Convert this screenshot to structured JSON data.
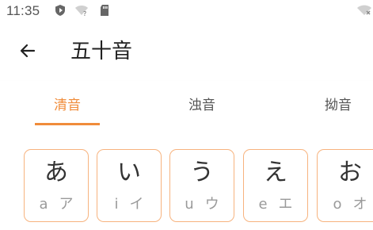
{
  "status_bar": {
    "time": "11:35",
    "icons": [
      "shield-icon",
      "wifi-question-icon",
      "sd-card-icon",
      "wifi-x-icon"
    ]
  },
  "toolbar": {
    "back_icon": "arrow-left-icon",
    "title": "五十音"
  },
  "tabs": [
    {
      "label": "清音",
      "active": true
    },
    {
      "label": "浊音",
      "active": false
    },
    {
      "label": "拗音",
      "active": false
    }
  ],
  "colors": {
    "accent": "#F08C3A",
    "card_border": "#F7B37E"
  },
  "kana": [
    {
      "hiragana": "あ",
      "romaji": "a",
      "katakana": "ア"
    },
    {
      "hiragana": "い",
      "romaji": "i",
      "katakana": "イ"
    },
    {
      "hiragana": "う",
      "romaji": "u",
      "katakana": "ウ"
    },
    {
      "hiragana": "え",
      "romaji": "e",
      "katakana": "エ"
    },
    {
      "hiragana": "お",
      "romaji": "o",
      "katakana": "オ"
    }
  ]
}
